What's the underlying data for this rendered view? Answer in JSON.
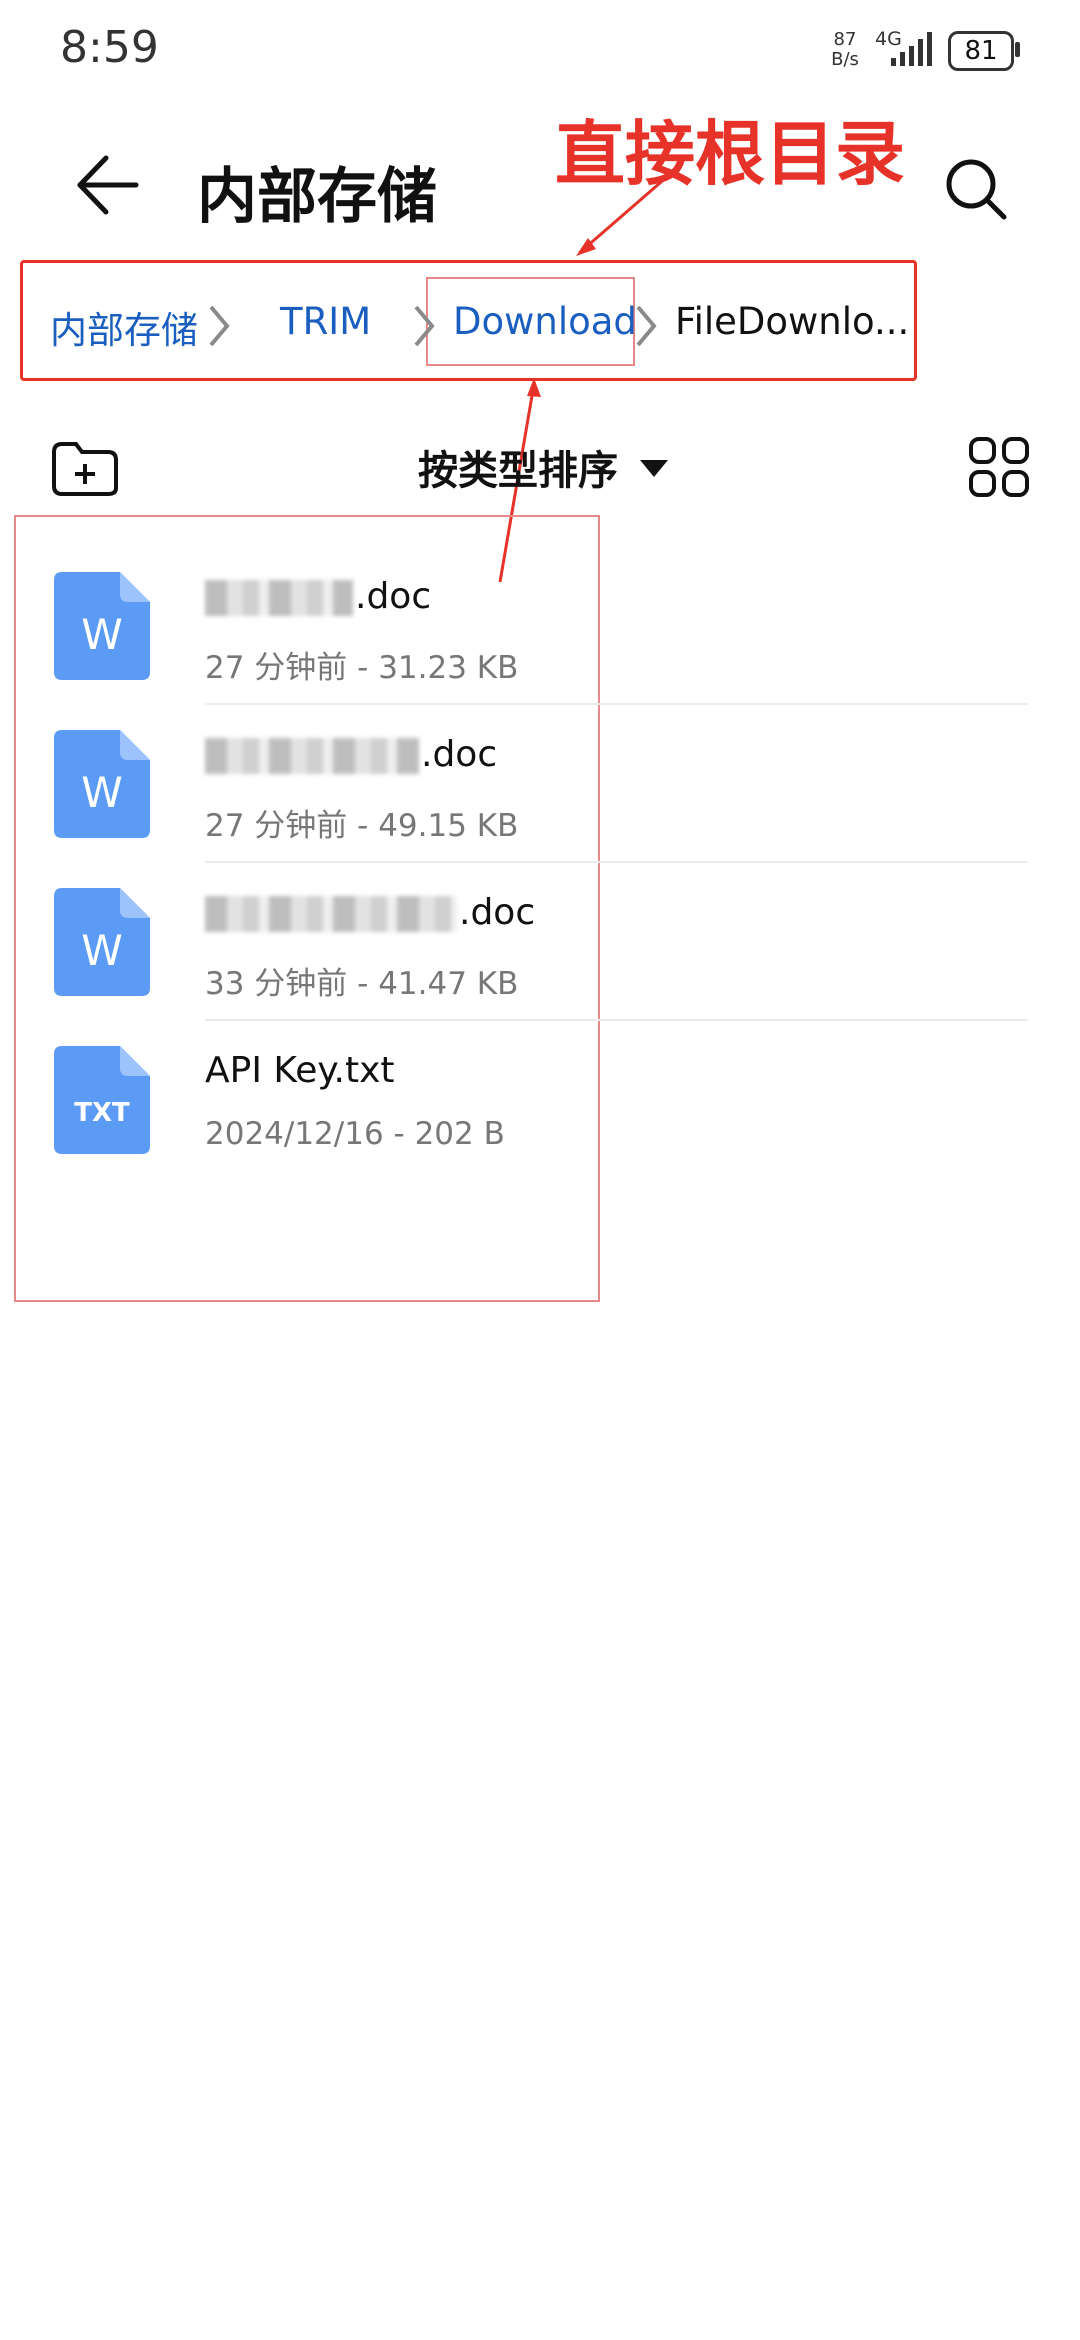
{
  "status_bar": {
    "time": "8:59",
    "net_speed_value": "87",
    "net_speed_unit": "B/s",
    "network_type": "4G",
    "battery": "81"
  },
  "header": {
    "title": "内部存储",
    "back_icon": "arrow-left-icon",
    "search_icon": "search-icon"
  },
  "annotation": {
    "text": "直接根目录",
    "color": "#e63228"
  },
  "breadcrumb": [
    {
      "label": "内部存储"
    },
    {
      "label": "TRIM"
    },
    {
      "label": "Download"
    },
    {
      "label": "FileDownlo..."
    }
  ],
  "toolbar": {
    "new_folder_icon": "new-folder-icon",
    "sort_label": "按类型排序",
    "view_toggle_icon": "grid-view-icon"
  },
  "files": [
    {
      "name_suffix": ".doc",
      "meta": "27 分钟前 - 31.23 KB",
      "icon_label": "W",
      "icon_color": "#5b9bf5"
    },
    {
      "name_suffix": ".doc",
      "meta": "27 分钟前 - 49.15 KB",
      "icon_label": "W",
      "icon_color": "#5b9bf5"
    },
    {
      "name_suffix": ".doc",
      "meta": "33 分钟前 - 41.47 KB",
      "icon_label": "W",
      "icon_color": "#5b9bf5"
    },
    {
      "name_suffix": "API Key.txt",
      "meta": "2024/12/16 - 202 B",
      "icon_label": "TXT",
      "icon_color": "#5b9bf5"
    }
  ]
}
